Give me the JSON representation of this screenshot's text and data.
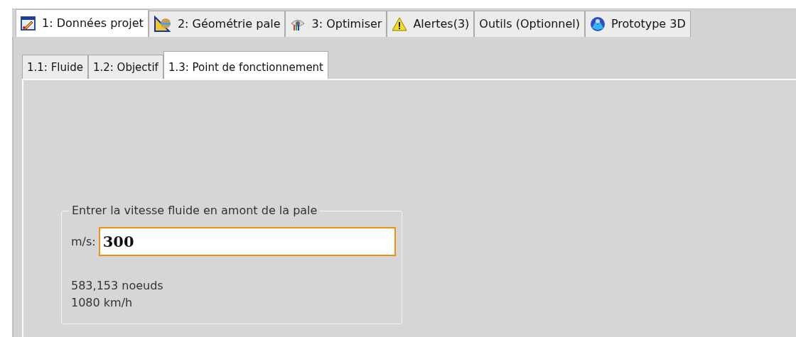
{
  "tabs": [
    {
      "label": "1: Données projet",
      "selected": true,
      "kind": "icon"
    },
    {
      "label": "2: Géométrie pale",
      "selected": false,
      "kind": "icon"
    },
    {
      "label": "3: Optimiser",
      "selected": false,
      "kind": "icon"
    },
    {
      "label": "Alertes(3)",
      "selected": false,
      "kind": "icon"
    },
    {
      "label": "Outils (Optionnel)",
      "selected": false,
      "kind": "text"
    },
    {
      "label": "Prototype 3D",
      "selected": false,
      "kind": "icon"
    }
  ],
  "subtabs": [
    {
      "label": "1.1: Fluide",
      "selected": false
    },
    {
      "label": "1.2: Objectif",
      "selected": false
    },
    {
      "label": "1.3: Point de fonctionnement",
      "selected": true
    }
  ],
  "group": {
    "title": "Entrer la vitesse fluide en amont de la pale",
    "unit_label": "m/s:",
    "value": "300",
    "focused": true,
    "readouts": [
      "583,153 noeuds",
      "1080 km/h"
    ]
  }
}
